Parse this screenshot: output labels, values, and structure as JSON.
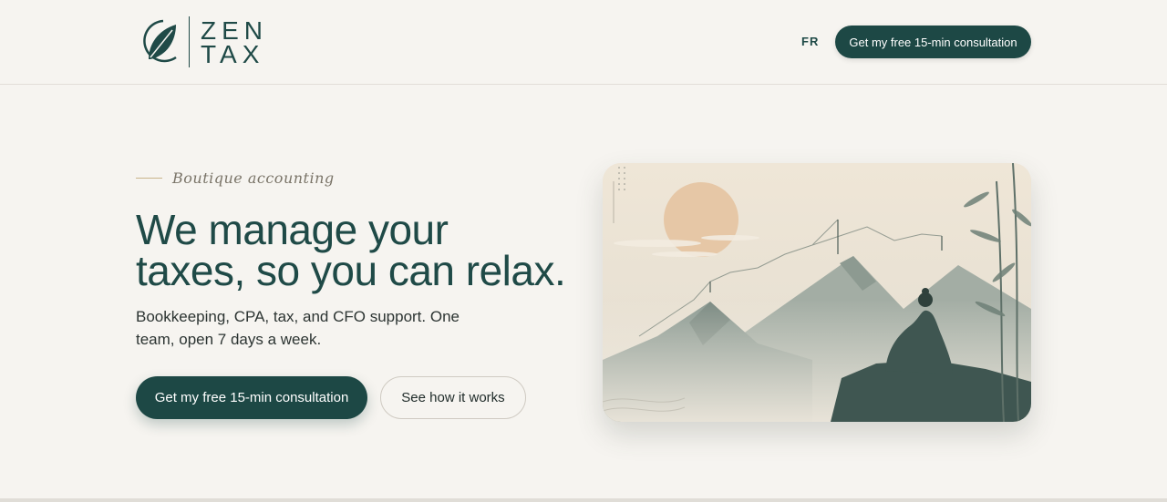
{
  "header": {
    "logo": {
      "line1": "ZEN",
      "line2": "TAX"
    },
    "language_toggle": "FR",
    "cta_label": "Get my free 15-min consultation"
  },
  "hero": {
    "eyebrow": "Boutique accounting",
    "headline_line1": "We manage your",
    "headline_line2": "taxes, so you can relax.",
    "subtitle": "Bookkeeping, CPA, tax, and CFO support. One team, open 7 days a week.",
    "primary_cta": "Get my free 15-min consultation",
    "secondary_cta": "See how it works",
    "illustration": "meditating-figure-mountains-illustration"
  },
  "colors": {
    "brand": "#1d4845",
    "background": "#f6f4f0",
    "accent_line": "#c9b38a",
    "sun": "#e8c9a8"
  }
}
